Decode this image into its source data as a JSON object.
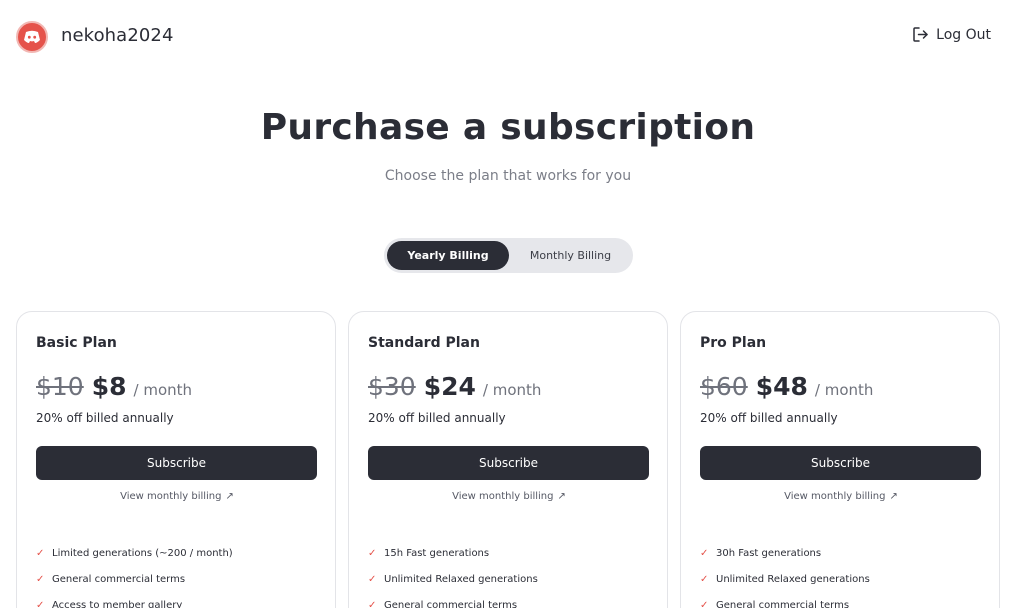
{
  "header": {
    "username": "nekoha2024",
    "logout_label": "Log Out"
  },
  "hero": {
    "title": "Purchase a subscription",
    "subtitle": "Choose the plan that works for you"
  },
  "billing_toggle": {
    "options": [
      "Yearly Billing",
      "Monthly Billing"
    ],
    "selected": "Yearly Billing"
  },
  "plans": [
    {
      "name": "Basic Plan",
      "old_price": "$10",
      "price": "$8",
      "period": "/ month",
      "discount": "20% off billed annually",
      "cta": "Subscribe",
      "link": "View monthly billing",
      "features": [
        "Limited generations (~200 / month)",
        "General commercial terms",
        "Access to member gallery"
      ]
    },
    {
      "name": "Standard Plan",
      "old_price": "$30",
      "price": "$24",
      "period": "/ month",
      "discount": "20% off billed annually",
      "cta": "Subscribe",
      "link": "View monthly billing",
      "features": [
        "15h Fast generations",
        "Unlimited Relaxed generations",
        "General commercial terms"
      ]
    },
    {
      "name": "Pro Plan",
      "old_price": "$60",
      "price": "$48",
      "period": "/ month",
      "discount": "20% off billed annually",
      "cta": "Subscribe",
      "link": "View monthly billing",
      "features": [
        "30h Fast generations",
        "Unlimited Relaxed generations",
        "General commercial terms"
      ]
    }
  ],
  "colors": {
    "accent": "#e5534b",
    "dark": "#2b2d36",
    "muted": "#7b7e88"
  }
}
